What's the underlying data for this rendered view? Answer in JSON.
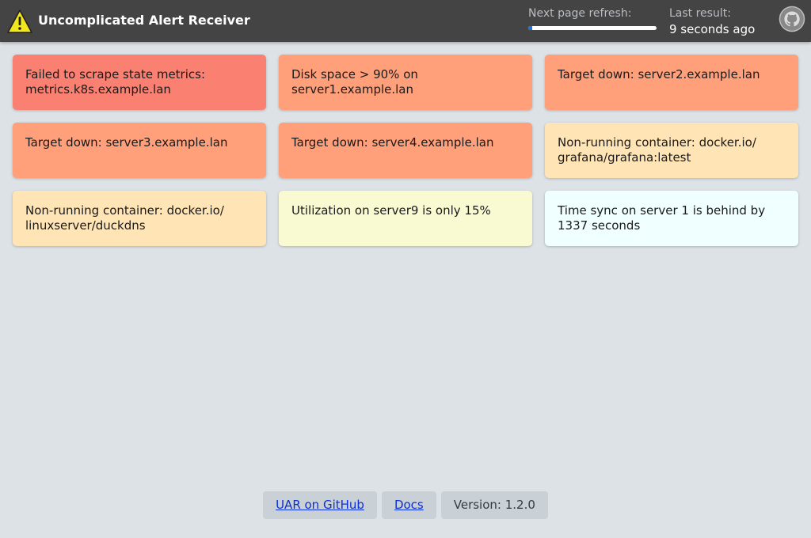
{
  "header": {
    "title": "Uncomplicated Alert Receiver",
    "logo_icon": "warning-triangle-icon",
    "refresh_label": "Next page refresh:",
    "refresh_progress": 0.03,
    "last_result_label": "Last result:",
    "last_result_value": "9 seconds ago",
    "github_icon": "github-icon"
  },
  "alerts": [
    {
      "text": "Failed to scrape state metrics: metrics.k8s.example.lan",
      "color": "#fa8072"
    },
    {
      "text": "Disk space > 90% on server1.example.lan",
      "color": "#ffa07a"
    },
    {
      "text": "Target down: server2.example.lan",
      "color": "#ffa07a"
    },
    {
      "text": "Target down: server3.example.lan",
      "color": "#ffa07a"
    },
    {
      "text": "Target down: server4.example.lan",
      "color": "#ffa07a"
    },
    {
      "text": "Non-running container: docker.io/ grafana/grafana:latest",
      "color": "#ffe4b5"
    },
    {
      "text": "Non-running container: docker.io/ linuxserver/duckdns",
      "color": "#ffe4b5"
    },
    {
      "text": "Utilization on server9 is only 15%",
      "color": "#fafad2"
    },
    {
      "text": "Time sync on server 1 is behind by 1337 seconds",
      "color": "#f0ffff"
    }
  ],
  "footer": {
    "github_link": "UAR on GitHub",
    "docs_link": "Docs",
    "version": "Version: 1.2.0"
  }
}
